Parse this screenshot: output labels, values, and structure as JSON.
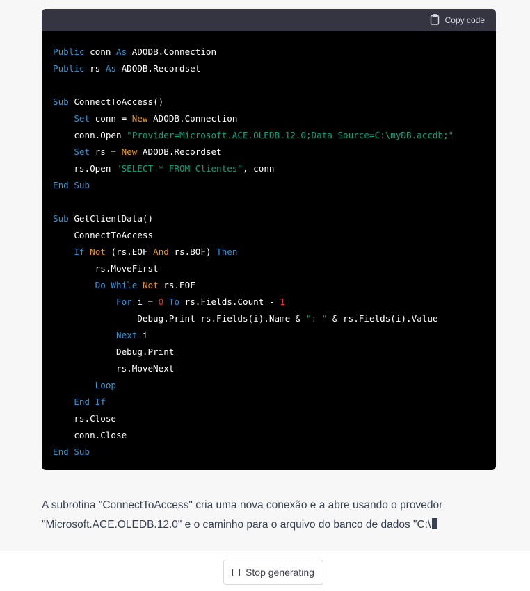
{
  "code_block": {
    "copy_label": "Copy code",
    "lines": [
      [
        {
          "t": "Public",
          "c": "kw"
        },
        {
          "t": " conn "
        },
        {
          "t": "As",
          "c": "kw"
        },
        {
          "t": " ADODB.Connection"
        }
      ],
      [
        {
          "t": "Public",
          "c": "kw"
        },
        {
          "t": " rs "
        },
        {
          "t": "As",
          "c": "kw"
        },
        {
          "t": " ADODB.Recordset"
        }
      ],
      [],
      [
        {
          "t": "Sub",
          "c": "kw"
        },
        {
          "t": " ConnectToAccess()"
        }
      ],
      [
        {
          "t": "    "
        },
        {
          "t": "Set",
          "c": "kw"
        },
        {
          "t": " conn = "
        },
        {
          "t": "New",
          "c": "nw"
        },
        {
          "t": " ADODB.Connection"
        }
      ],
      [
        {
          "t": "    conn.Open "
        },
        {
          "t": "\"Provider=Microsoft.ACE.OLEDB.12.0;Data Source=C:\\myDB.accdb;\"",
          "c": "str"
        }
      ],
      [
        {
          "t": "    "
        },
        {
          "t": "Set",
          "c": "kw"
        },
        {
          "t": " rs = "
        },
        {
          "t": "New",
          "c": "nw"
        },
        {
          "t": " ADODB.Recordset"
        }
      ],
      [
        {
          "t": "    rs.Open "
        },
        {
          "t": "\"SELECT * FROM Clientes\"",
          "c": "str"
        },
        {
          "t": ", conn"
        }
      ],
      [
        {
          "t": "End Sub",
          "c": "kw"
        }
      ],
      [],
      [
        {
          "t": "Sub",
          "c": "kw"
        },
        {
          "t": " GetClientData()"
        }
      ],
      [
        {
          "t": "    ConnectToAccess"
        }
      ],
      [
        {
          "t": "    "
        },
        {
          "t": "If",
          "c": "kw"
        },
        {
          "t": " "
        },
        {
          "t": "Not",
          "c": "nw"
        },
        {
          "t": " (rs.EOF "
        },
        {
          "t": "And",
          "c": "nw"
        },
        {
          "t": " rs.BOF) "
        },
        {
          "t": "Then",
          "c": "kw"
        }
      ],
      [
        {
          "t": "        rs.MoveFirst"
        }
      ],
      [
        {
          "t": "        "
        },
        {
          "t": "Do While",
          "c": "kw"
        },
        {
          "t": " "
        },
        {
          "t": "Not",
          "c": "nw"
        },
        {
          "t": " rs.EOF"
        }
      ],
      [
        {
          "t": "            "
        },
        {
          "t": "For",
          "c": "kw"
        },
        {
          "t": " i = "
        },
        {
          "t": "0",
          "c": "kwo"
        },
        {
          "t": " "
        },
        {
          "t": "To",
          "c": "kw"
        },
        {
          "t": " rs.Fields.Count - "
        },
        {
          "t": "1",
          "c": "kwo"
        }
      ],
      [
        {
          "t": "                Debug.Print rs.Fields(i).Name & "
        },
        {
          "t": "\": \"",
          "c": "str"
        },
        {
          "t": " & rs.Fields(i).Value"
        }
      ],
      [
        {
          "t": "            "
        },
        {
          "t": "Next",
          "c": "kw"
        },
        {
          "t": " i"
        }
      ],
      [
        {
          "t": "            Debug.Print"
        }
      ],
      [
        {
          "t": "            rs.MoveNext"
        }
      ],
      [
        {
          "t": "        "
        },
        {
          "t": "Loop",
          "c": "kw"
        }
      ],
      [
        {
          "t": "    "
        },
        {
          "t": "End If",
          "c": "kw"
        }
      ],
      [
        {
          "t": "    rs.Close"
        }
      ],
      [
        {
          "t": "    conn.Close"
        }
      ],
      [
        {
          "t": "End Sub",
          "c": "kw"
        }
      ]
    ]
  },
  "answer": {
    "text": "A subrotina \"ConnectToAccess\" cria uma nova conexão e a abre usando o provedor \"Microsoft.ACE.OLEDB.12.0\" e o caminho para o arquivo do banco de dados \"C:\\"
  },
  "footer": {
    "stop_label": "Stop generating"
  },
  "icons": {
    "copy": "clipboard-icon",
    "stop": "stop-square-icon"
  }
}
